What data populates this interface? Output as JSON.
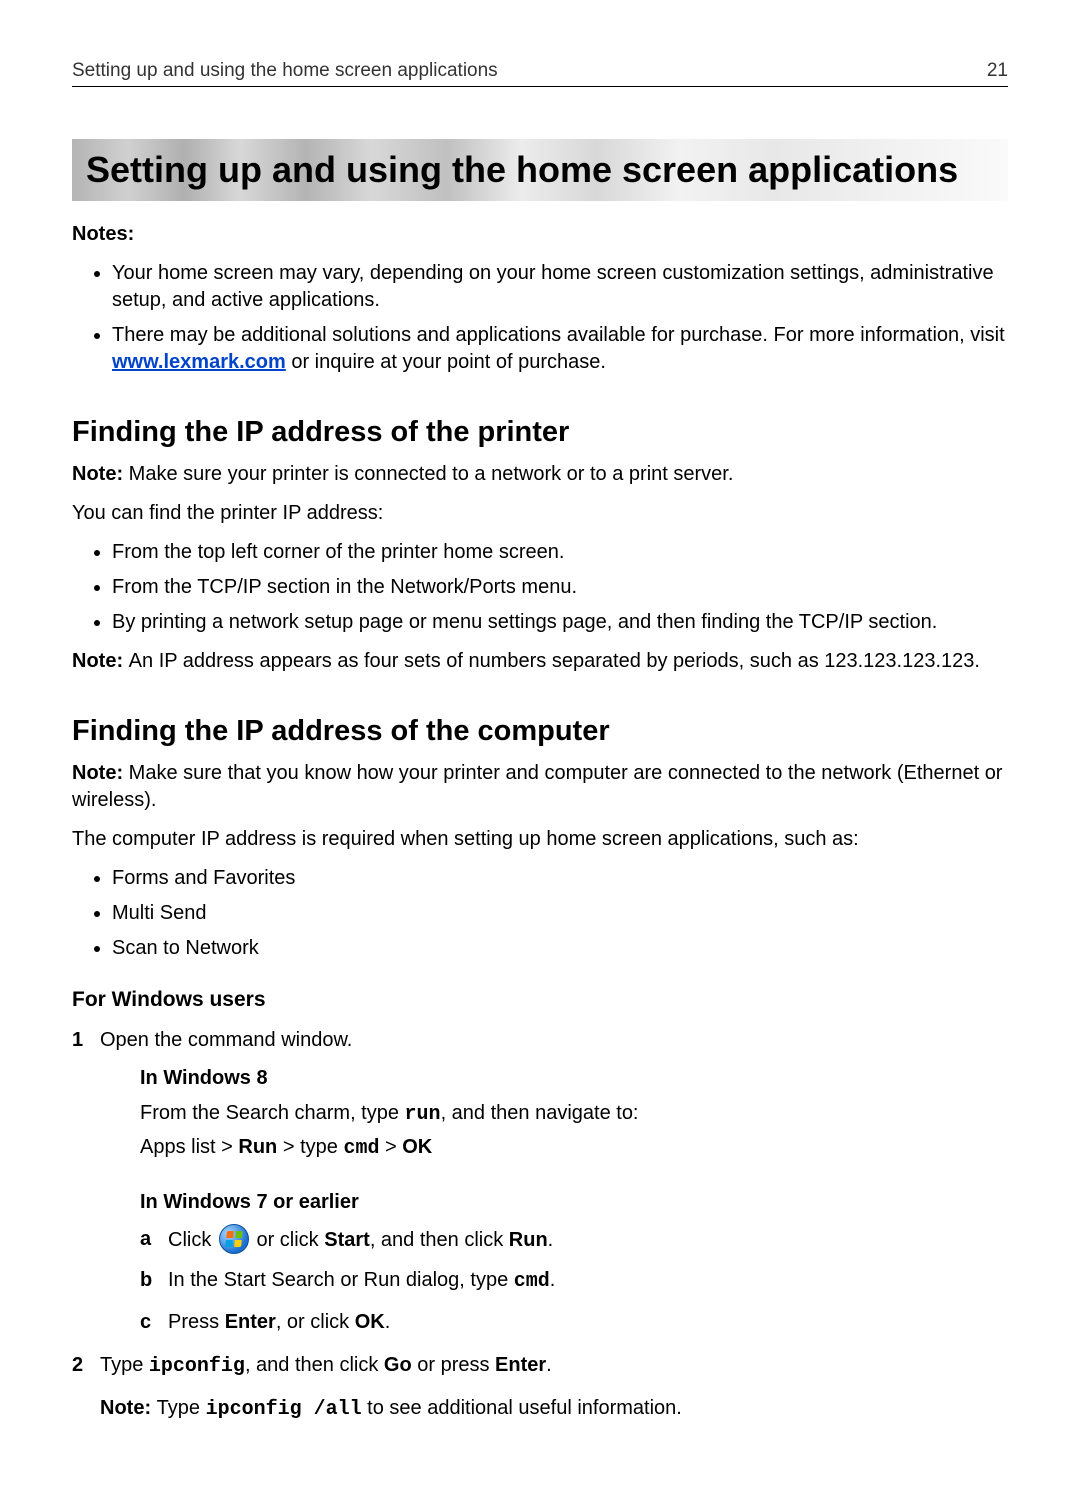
{
  "header": {
    "title": "Setting up and using the home screen applications",
    "page_number": "21"
  },
  "main_title": "Setting up and using the home screen applications",
  "notes_label": "Notes:",
  "top_notes": [
    {
      "text": "Your home screen may vary, depending on your home screen customization settings, administrative setup, and active applications."
    },
    {
      "prefix": "There may be additional solutions and applications available for purchase. For more information, visit ",
      "link_text": "www.lexmark.com",
      "link_href": "http://www.lexmark.com",
      "suffix": " or inquire at your point of purchase."
    }
  ],
  "section1": {
    "heading": "Finding the IP address of the printer",
    "note_label": "Note: ",
    "note_text": "Make sure your printer is connected to a network or to a print server.",
    "intro": "You can find the printer IP address:",
    "bullets": [
      "From the top left corner of the printer home screen.",
      "From the TCP/IP section in the Network/Ports menu.",
      "By printing a network setup page or menu settings page, and then finding the TCP/IP section."
    ],
    "footnote_label": "Note: ",
    "footnote_text": "An IP address appears as four sets of numbers separated by periods, such as 123.123.123.123."
  },
  "section2": {
    "heading": "Finding the IP address of the computer",
    "note_label": "Note: ",
    "note_text": "Make sure that you know how your printer and computer are connected to the network (Ethernet or wireless).",
    "intro": "The computer IP address is required when setting up home screen applications, such as:",
    "bullets": [
      "Forms and Favorites",
      "Multi Send",
      "Scan to Network"
    ],
    "windows_heading": "For Windows users",
    "steps": {
      "step1": "Open the command window.",
      "in_win8_heading": "In Windows 8",
      "in_win8_line": {
        "p1": "From the Search charm, type ",
        "run_cmd": "run",
        "p2": ", and then navigate to:"
      },
      "in_win8_path": {
        "apps_list": "Apps list > ",
        "run": "Run",
        "gt_type": " > type ",
        "cmd": "cmd",
        "gt": " > ",
        "ok": "OK"
      },
      "in_win7_heading": "In Windows 7 or earlier",
      "letters": {
        "a": {
          "click": "Click ",
          "or_click": " or click ",
          "start": "Start",
          "then_click": ", and then click ",
          "run": "Run",
          "end": "."
        },
        "b": {
          "p1": "In the Start Search or Run dialog, type ",
          "cmd": "cmd",
          "end": "."
        },
        "c": {
          "p1": "Press ",
          "enter": "Enter",
          "p2": ", or click ",
          "ok": "OK",
          "end": "."
        }
      },
      "step2": {
        "p1": "Type ",
        "ipconfig": "ipconfig",
        "p2": ", and then click ",
        "go": "Go",
        "p3": " or press ",
        "enter": "Enter",
        "end": "."
      },
      "step2_note": {
        "label": "Note: ",
        "p1": "Type ",
        "ipconfig_all": "ipconfig /all",
        "p2": " to see additional useful information."
      }
    }
  }
}
